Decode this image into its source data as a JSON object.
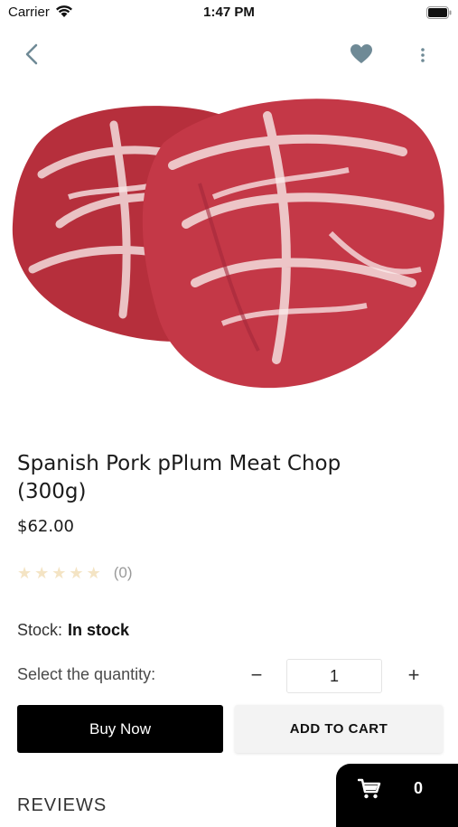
{
  "status_bar": {
    "carrier": "Carrier",
    "time": "1:47 PM"
  },
  "product": {
    "title": "Spanish Pork pPlum Meat Chop (300g)",
    "price": "$62.00",
    "rating_count": "(0)",
    "rating_value": 0,
    "rating_max": 5,
    "stock_label": "Stock:",
    "stock_value": "In stock"
  },
  "quantity": {
    "label": "Select the quantity:",
    "minus": "−",
    "value": "1",
    "plus": "+"
  },
  "actions": {
    "buy_now": "Buy Now",
    "add_to_cart": "ADD TO CART"
  },
  "reviews": {
    "heading": "REVIEWS"
  },
  "cart": {
    "count": "0"
  },
  "icons": {
    "back": "chevron-left-icon",
    "favorite": "heart-icon",
    "more": "more-vertical-icon",
    "cart": "shopping-cart-icon"
  },
  "colors": {
    "nav_icon": "#6f8a96",
    "star_empty": "#f4e4c4",
    "buy_now_bg": "#000000",
    "add_to_cart_bg": "#f3f3f3"
  }
}
